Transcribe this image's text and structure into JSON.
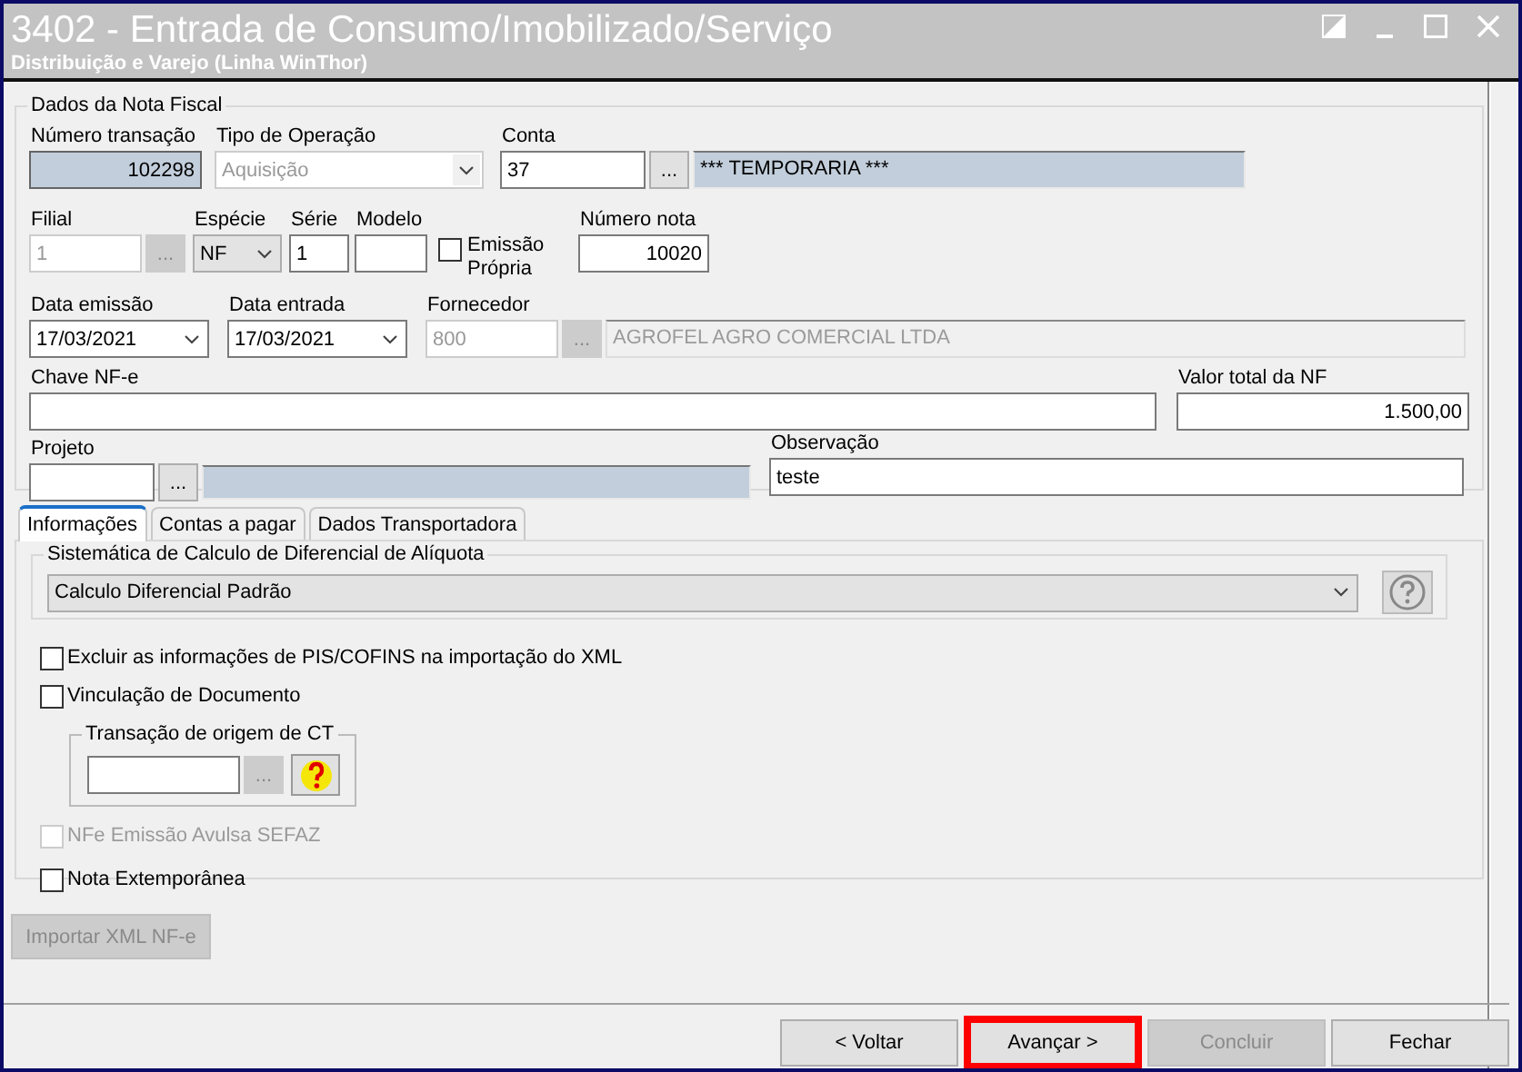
{
  "window": {
    "title": "3402 - Entrada de Consumo/Imobilizado/Serviço",
    "subtitle": "Distribuição e Varejo (Linha WinThor)"
  },
  "nota_fiscal": {
    "legend": "Dados da Nota Fiscal",
    "numero_transacao": {
      "label": "Número transação",
      "value": "102298"
    },
    "tipo_operacao": {
      "label": "Tipo de Operação",
      "value": "Aquisição",
      "disabled": true
    },
    "conta": {
      "label": "Conta",
      "value": "37",
      "button": "...",
      "description": "*** TEMPORARIA ***"
    },
    "filial": {
      "label": "Filial",
      "value": "1",
      "button": "...",
      "disabled": true
    },
    "especie": {
      "label": "Espécie",
      "value": "NF",
      "disabled": false
    },
    "serie": {
      "label": "Série",
      "value": "1"
    },
    "modelo": {
      "label": "Modelo"
    },
    "emissao_propria": {
      "label": "Emissão Própria",
      "checked": false
    },
    "numero_nota": {
      "label": "Número nota",
      "value": "10020"
    },
    "data_emissao": {
      "label": "Data emissão",
      "value": "17/03/2021"
    },
    "data_entrada": {
      "label": "Data entrada",
      "value": "17/03/2021"
    },
    "fornecedor": {
      "label": "Fornecedor",
      "value": "800",
      "button": "...",
      "description": "AGROFEL AGRO COMERCIAL LTDA",
      "disabled": true
    },
    "chave_nfe": {
      "label": "Chave NF-e"
    },
    "valor_total": {
      "label": "Valor total da NF",
      "value": "1.500,00"
    },
    "projeto": {
      "label": "Projeto",
      "button": "..."
    },
    "observacao": {
      "label": "Observação",
      "value": "teste"
    }
  },
  "tabs": [
    {
      "label": "Informações",
      "selected": true
    },
    {
      "label": "Contas a pagar",
      "selected": false
    },
    {
      "label": "Dados Transportadora",
      "selected": false
    }
  ],
  "informacoes": {
    "sistematica": {
      "legend": "Sistemática de Calculo de Diferencial de Alíquota",
      "value": "Calculo Diferencial Padrão"
    },
    "options": [
      {
        "label": "Excluir as informações de PIS/COFINS na importação do XML",
        "checked": false,
        "disabled": false
      },
      {
        "label": "Vinculação de Documento",
        "checked": false,
        "disabled": false
      }
    ],
    "transacao_origem": {
      "legend": "Transação de origem de CT",
      "button": "..."
    },
    "more_options": [
      {
        "label": "NFe Emissão Avulsa SEFAZ",
        "checked": false,
        "disabled": true
      },
      {
        "label": "Nota Extemporânea",
        "checked": false,
        "disabled": false
      }
    ]
  },
  "import_button": {
    "label": "Importar XML NF-e",
    "disabled": true
  },
  "buttons": [
    {
      "label": "< Voltar",
      "disabled": false,
      "highlighted": false
    },
    {
      "label": "Avançar >",
      "disabled": false,
      "highlighted": true
    },
    {
      "label": "Concluir",
      "disabled": true,
      "highlighted": false
    },
    {
      "label": "Fechar",
      "disabled": false,
      "highlighted": false
    }
  ]
}
